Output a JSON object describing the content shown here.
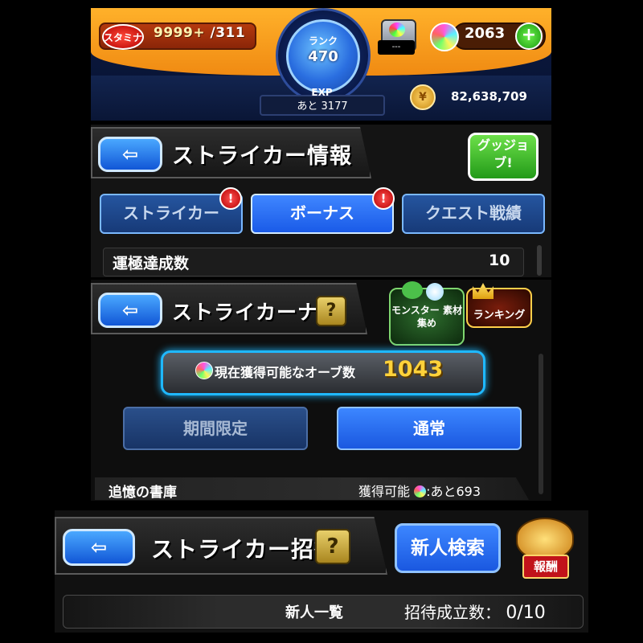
{
  "status_bar": {
    "stamina_label": "スタミナ",
    "stamina_current": "9999+",
    "stamina_max": "/311",
    "rank_label": "ランク",
    "rank_value": "470",
    "exp_label": "EXP",
    "exp_remaining": "あと 3177",
    "chest_label": "---",
    "orb_count": "2063",
    "coin_count": "82,638,709"
  },
  "striker_info": {
    "title": "ストライカー情報",
    "good_job_label": "グッジョブ!",
    "tabs": [
      {
        "label": "ストライカー",
        "alert": "!"
      },
      {
        "label": "ボーナス",
        "alert": "!"
      },
      {
        "label": "クエスト戦績",
        "alert": ""
      }
    ],
    "row_label": "運極達成数",
    "row_value": "10"
  },
  "striker_navi": {
    "title": "ストライカーナビ",
    "help": "?",
    "monster_collect_label": "モンスター 素材集め",
    "ranking_label": "ランキング",
    "orb_available_label": "現在獲得可能なオーブ数",
    "orb_available_value": "1043",
    "tab_limited": "期間限定",
    "tab_normal": "通常",
    "quest_name": "追憶の書庫",
    "quest_available_prefix": "獲得可能",
    "quest_available_suffix": ":あと693"
  },
  "striker_invite": {
    "title": "ストライカー招待",
    "help": "?",
    "search_button": "新人検索",
    "reward_label": "報酬",
    "newcomer_list": "新人一覧",
    "invite_count_label": "招待成立数：",
    "invite_count_value": "0/10"
  }
}
